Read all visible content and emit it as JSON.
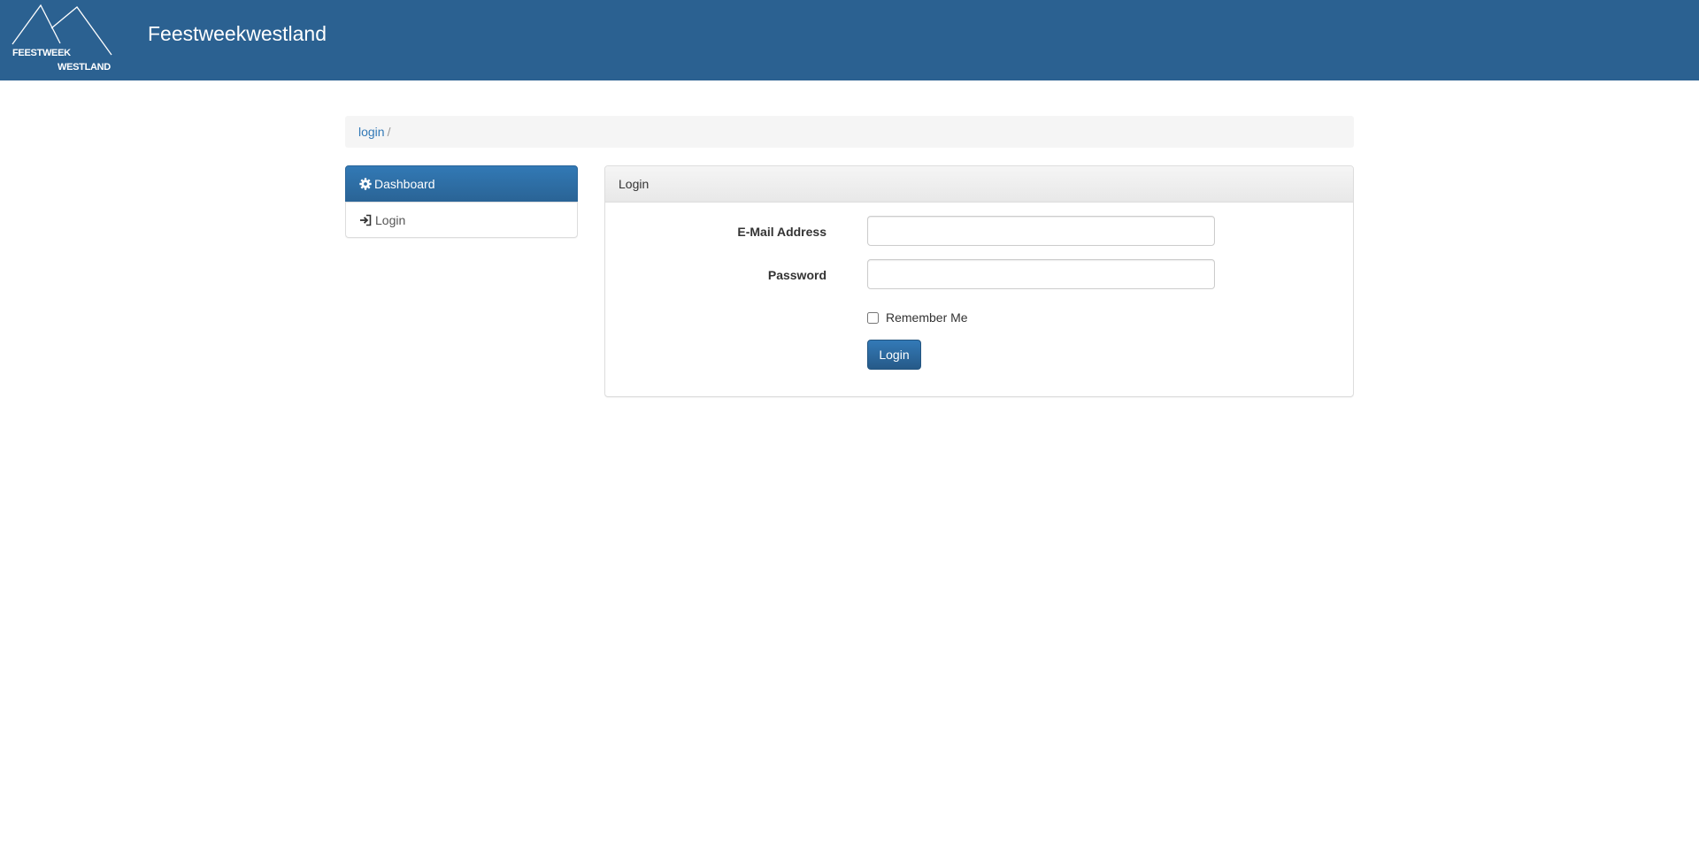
{
  "header": {
    "logo_line1": "FEESTWEEK",
    "logo_line2": "WESTLAND",
    "site_title": "Feestweekwestland"
  },
  "breadcrumb": {
    "link": "login",
    "separator": "/"
  },
  "sidebar": {
    "items": [
      {
        "label": "Dashboard",
        "icon": "gear-icon",
        "active": true
      },
      {
        "label": "Login",
        "icon": "sign-in-icon",
        "active": false
      }
    ]
  },
  "login_panel": {
    "title": "Login",
    "email_label": "E-Mail Address",
    "email_value": "",
    "password_label": "Password",
    "password_value": "",
    "remember_label": "Remember Me",
    "remember_checked": false,
    "submit_label": "Login"
  },
  "colors": {
    "header_bg": "#2b6191",
    "primary": "#337ab7",
    "breadcrumb_bg": "#f5f5f5"
  }
}
